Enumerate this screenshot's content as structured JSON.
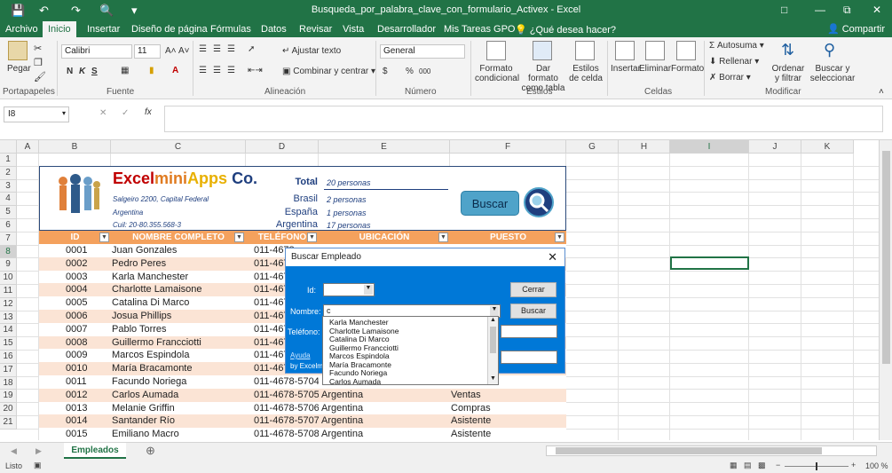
{
  "window": {
    "title": "Busqueda_por_palabra_clave_con_formulario_Activex - Excel"
  },
  "tabs": [
    {
      "label": "Archivo"
    },
    {
      "label": "Inicio"
    },
    {
      "label": "Insertar"
    },
    {
      "label": "Diseño de página"
    },
    {
      "label": "Fórmulas"
    },
    {
      "label": "Datos"
    },
    {
      "label": "Revisar"
    },
    {
      "label": "Vista"
    },
    {
      "label": "Desarrollador"
    },
    {
      "label": "Mis Tareas GPO"
    },
    {
      "label": "¿Qué desea hacer?"
    }
  ],
  "share_label": "Compartir",
  "ribbon": {
    "paste": "Pegar",
    "font_name": "Calibri",
    "font_size": "11",
    "bold": "N",
    "italic": "K",
    "underline": "S",
    "wrap_text": "Ajustar texto",
    "merge_center": "Combinar y centrar",
    "number_format": "General",
    "currency": "$",
    "percent": "%",
    "thousands": "000",
    "cond_format": "Formato condicional",
    "table_format": "Dar formato como tabla",
    "cell_styles": "Estilos de celda",
    "insert": "Insertar",
    "delete": "Eliminar",
    "format": "Formato",
    "autosum": "Autosuma",
    "fill": "Rellenar",
    "clear": "Borrar",
    "sort_filter": "Ordenar y filtrar",
    "find_select": "Buscar y seleccionar",
    "groups": {
      "clipboard": "Portapapeles",
      "font": "Fuente",
      "alignment": "Alineación",
      "number": "Número",
      "styles": "Estilos",
      "cells": "Celdas",
      "modify": "Modificar"
    }
  },
  "formula_bar": {
    "name_box": "I8",
    "fx": "fx",
    "content": ""
  },
  "columns": [
    "A",
    "B",
    "C",
    "D",
    "E",
    "F",
    "G",
    "H",
    "I",
    "J",
    "K"
  ],
  "rows": [
    "1",
    "2",
    "3",
    "4",
    "5",
    "6",
    "7",
    "8",
    "9",
    "10",
    "11",
    "12",
    "13",
    "14",
    "15",
    "16",
    "17",
    "18",
    "19",
    "20",
    "21"
  ],
  "header_block": {
    "app_name_part1": "Excel",
    "app_name_part2": "mini",
    "app_name_part3": "Apps",
    "app_name_part4": " Co.",
    "address": "Salgeiro 2200, Capital Federal",
    "country": "Argentina",
    "cuil": "Cuil: 20-80.355.568-3",
    "total_label": "Total",
    "total_value": "20 personas",
    "brasil_label": "Brasil",
    "brasil_value": "2 personas",
    "espana_label": "España",
    "espana_value": "1 personas",
    "argentina_label": "Argentina",
    "argentina_value": "17 personas",
    "search_button": "Buscar"
  },
  "table": {
    "headers": [
      "ID",
      "NOMBRE COMPLETO",
      "TELÉFONO",
      "UBICACIÓN",
      "PUESTO"
    ],
    "rows": [
      {
        "id": "0001",
        "name": "Juan Gonzales",
        "phone": "011-4678",
        "location": "",
        "position": ""
      },
      {
        "id": "0002",
        "name": "Pedro Peres",
        "phone": "011-4678",
        "location": "",
        "position": ""
      },
      {
        "id": "0003",
        "name": "Karla Manchester",
        "phone": "011-4678",
        "location": "",
        "position": ""
      },
      {
        "id": "0004",
        "name": "Charlotte Lamaisone",
        "phone": "011-4678",
        "location": "",
        "position": ""
      },
      {
        "id": "0005",
        "name": "Catalina Di Marco",
        "phone": "011-4678",
        "location": "",
        "position": ""
      },
      {
        "id": "0006",
        "name": "Josua Phillips",
        "phone": "011-4678",
        "location": "",
        "position": ""
      },
      {
        "id": "0007",
        "name": "Pablo Torres",
        "phone": "011-4678",
        "location": "",
        "position": ""
      },
      {
        "id": "0008",
        "name": "Guillermo Francciotti",
        "phone": "011-4678",
        "location": "",
        "position": ""
      },
      {
        "id": "0009",
        "name": "Marcos Espindola",
        "phone": "011-4678",
        "location": "",
        "position": ""
      },
      {
        "id": "0010",
        "name": "María Bracamonte",
        "phone": "011-4678",
        "location": "",
        "position": ""
      },
      {
        "id": "0011",
        "name": "Facundo Noriega",
        "phone": "011-4678-5704",
        "location": "",
        "position": ""
      },
      {
        "id": "0012",
        "name": "Carlos Aumada",
        "phone": "011-4678-5705",
        "location": "Argentina",
        "position": "Ventas"
      },
      {
        "id": "0013",
        "name": "Melanie Griffin",
        "phone": "011-4678-5706",
        "location": "Argentina",
        "position": "Compras"
      },
      {
        "id": "0014",
        "name": "Santander Río",
        "phone": "011-4678-5707",
        "location": "Argentina",
        "position": "Asistente"
      },
      {
        "id": "0015",
        "name": "Emiliano Macro",
        "phone": "011-4678-5708",
        "location": "Argentina",
        "position": "Asistente"
      }
    ]
  },
  "dialog": {
    "title": "Buscar Empleado",
    "id_label": "Id:",
    "name_label": "Nombre:",
    "phone_label": "Teléfono:",
    "name_value": "c",
    "close_button": "Cerrar",
    "search_button": "Buscar",
    "help_link": "Ayuda",
    "by_text": "by Excelmi",
    "options": [
      "Karla Manchester",
      "Charlotte Lamaisone",
      "Catalina Di Marco",
      "Guillermo Francciotti",
      "Marcos Espindola",
      "María Bracamonte",
      "Facundo Noriega",
      "Carlos Aumada"
    ]
  },
  "sheet_tab": "Empleados",
  "status": {
    "ready": "Listo",
    "zoom": "100 %"
  },
  "colors": {
    "excel_green": "#217346",
    "table_header": "#f4a15d",
    "row_alt": "#fbe4d5",
    "dialog_blue": "#0078d7",
    "navy": "#1f3f7f"
  }
}
